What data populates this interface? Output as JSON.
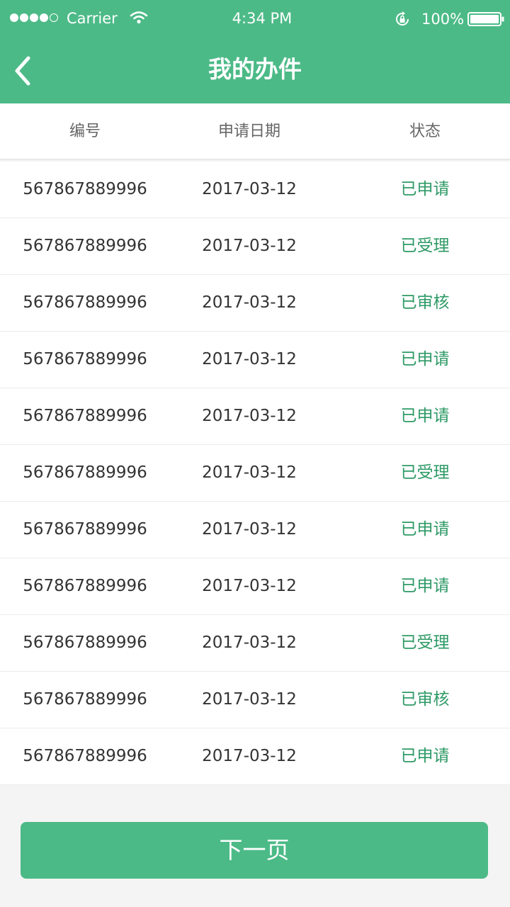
{
  "status_bar": {
    "carrier": "Carrier",
    "time": "4:34 PM",
    "battery": "100%",
    "icons": [
      "signal-icon",
      "wifi-icon",
      "rotation-lock-icon",
      "battery-icon"
    ]
  },
  "nav": {
    "back_icon": "chevron-left-icon",
    "title": "我的办件"
  },
  "table": {
    "headers": [
      "编号",
      "申请日期",
      "状态"
    ],
    "rows": [
      {
        "id": "567867889996",
        "date": "2017-03-12",
        "status": "已申请"
      },
      {
        "id": "567867889996",
        "date": "2017-03-12",
        "status": "已受理"
      },
      {
        "id": "567867889996",
        "date": "2017-03-12",
        "status": "已审核"
      },
      {
        "id": "567867889996",
        "date": "2017-03-12",
        "status": "已申请"
      },
      {
        "id": "567867889996",
        "date": "2017-03-12",
        "status": "已申请"
      },
      {
        "id": "567867889996",
        "date": "2017-03-12",
        "status": "已受理"
      },
      {
        "id": "567867889996",
        "date": "2017-03-12",
        "status": "已申请"
      },
      {
        "id": "567867889996",
        "date": "2017-03-12",
        "status": "已申请"
      },
      {
        "id": "567867889996",
        "date": "2017-03-12",
        "status": "已受理"
      },
      {
        "id": "567867889996",
        "date": "2017-03-12",
        "status": "已审核"
      },
      {
        "id": "567867889996",
        "date": "2017-03-12",
        "status": "已申请"
      }
    ]
  },
  "footer": {
    "next_label": "下一页"
  },
  "colors": {
    "brand": "#4cba87",
    "status_text": "#2e9a66",
    "background": "#f4f4f4"
  }
}
